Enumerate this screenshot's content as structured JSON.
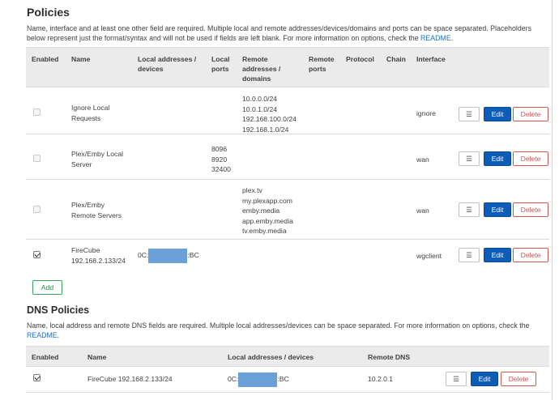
{
  "policies": {
    "title": "Policies",
    "description": "Name, interface and at least one other field are required. Multiple local and remote addresses/devices/domains and ports can be space separated. Placeholders below represent just the format/syntax and will not be used if fields are left blank. For more information on options, check the ",
    "readme_link": "README",
    "readme_suffix": ".",
    "columns": {
      "enabled": "Enabled",
      "name": "Name",
      "local_addresses": "Local addresses / devices",
      "local_ports": "Local ports",
      "remote_addresses": "Remote addresses / domains",
      "remote_ports": "Remote ports",
      "protocol": "Protocol",
      "chain": "Chain",
      "interface": "Interface"
    },
    "rows": [
      {
        "enabled": false,
        "name": "Ignore Local Requests",
        "local_addresses_prefix": "",
        "local_addresses_suffix": "",
        "local_ports": "",
        "remote_addresses": "10.0.0.0/24\n10.0.1.0/24\n192.168.100.0/24\n192.168.1.0/24",
        "interface": "ignore"
      },
      {
        "enabled": false,
        "name": "Plex/Emby Local Server",
        "local_addresses_prefix": "",
        "local_addresses_suffix": "",
        "local_ports": "8096\n8920\n32400",
        "remote_addresses": "",
        "interface": "wan"
      },
      {
        "enabled": false,
        "name": "Plex/Emby Remote Servers",
        "local_addresses_prefix": "",
        "local_addresses_suffix": "",
        "local_ports": "",
        "remote_addresses": "plex.tv\nmy.plexapp.com\nemby.media\napp.emby.media\ntv.emby.media",
        "interface": "wan"
      },
      {
        "enabled": true,
        "name": "FireCube 192.168.2.133/24",
        "local_addresses_prefix": "0C:",
        "local_addresses_suffix": ":BC",
        "local_ports": "",
        "remote_addresses": "",
        "interface": "wgclient"
      }
    ],
    "actions": {
      "menu": "☰",
      "edit": "Edit",
      "delete": "Delete"
    },
    "add_label": "Add"
  },
  "dns_policies": {
    "title": "DNS Policies",
    "description": "Name, local address and remote DNS fields are required. Multiple local addresses/devices can be space separated. For more information on options, check the ",
    "readme_link": "README",
    "readme_suffix": ".",
    "columns": {
      "enabled": "Enabled",
      "name": "Name",
      "local_addresses": "Local addresses / devices",
      "remote_dns": "Remote DNS"
    },
    "rows": [
      {
        "enabled": true,
        "name": "FireCube 192.168.2.133/24",
        "local_addresses_prefix": "0C:",
        "local_addresses_suffix": ":BC",
        "remote_dns": "10.2.0.1"
      }
    ],
    "actions": {
      "menu": "☰",
      "edit": "Edit",
      "delete": "Delete"
    }
  },
  "colors": {
    "edit": "#0d5cb8",
    "delete": "#d9534f",
    "add": "#3aa55a",
    "link": "#1f6fbf",
    "redaction": "#6a9fd8"
  }
}
